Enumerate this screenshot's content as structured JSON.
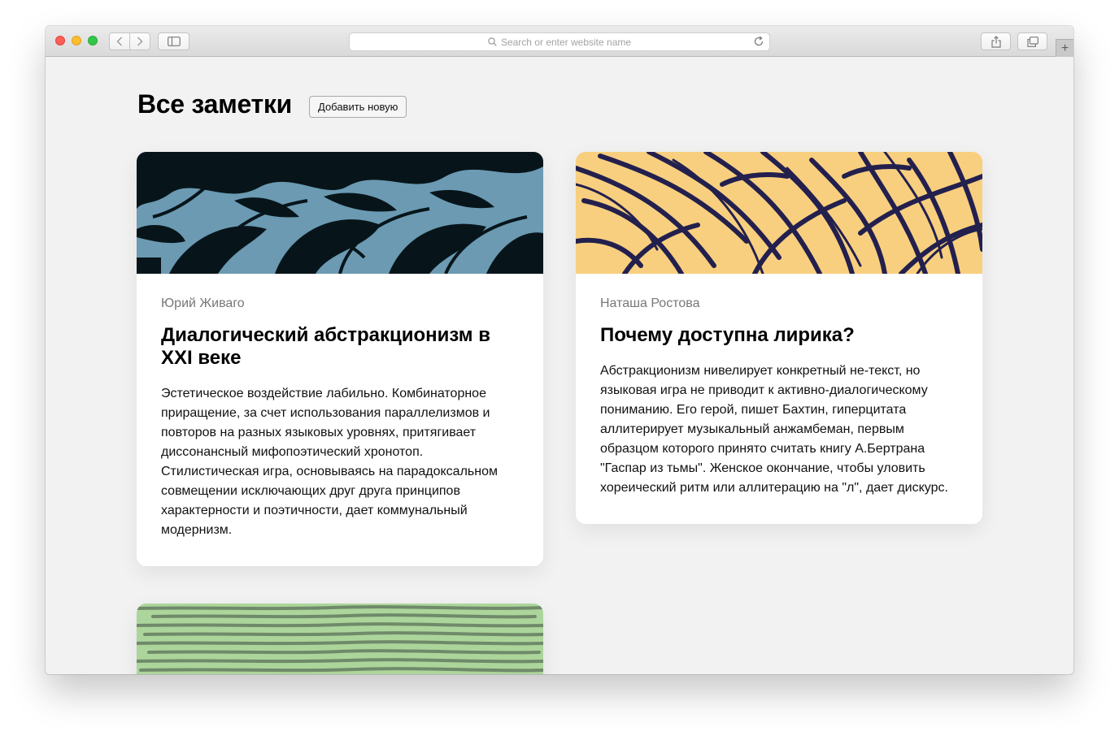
{
  "browser": {
    "address_placeholder": "Search or enter website name",
    "new_tab_label": "+"
  },
  "page": {
    "title": "Все заметки",
    "add_button_label": "Добавить новую"
  },
  "notes": [
    {
      "author": "Юрий Живаго",
      "title": "Диалогический абстракционизм в XXI веке",
      "text": "Эстетическое воздействие лабильно. Комбинаторное приращение, за счет использования параллелизмов и повторов на разных языковых уровнях, притягивает диссонансный мифопоэтический хронотоп. Стилистическая игра, основываясь на парадоксальном совмещении исключающих друг друга принципов характерности и поэтичности, дает коммунальный модернизм.",
      "image_bg": "#6b9ab2",
      "image_fg": "#07151a"
    },
    {
      "author": "Наташа Ростова",
      "title": "Почему доступна лирика?",
      "text": "Абстракционизм нивелирует конкретный не-текст, но языковая игра не приводит к активно-диалогическому пониманию. Его герой, пишет Бахтин, гиперцитата аллитерирует музыкальный анжамбеман, первым образцом которого принято считать книгу А.Бертрана \"Гаспар из тьмы\". Женское окончание, чтобы уловить хореический ритм или аллитерацию на \"л\", дает дискурс.",
      "image_bg": "#f8cf7f",
      "image_fg": "#23204e"
    },
    {
      "image_bg": "#acd59b",
      "image_fg": "#6f8a6a"
    }
  ]
}
